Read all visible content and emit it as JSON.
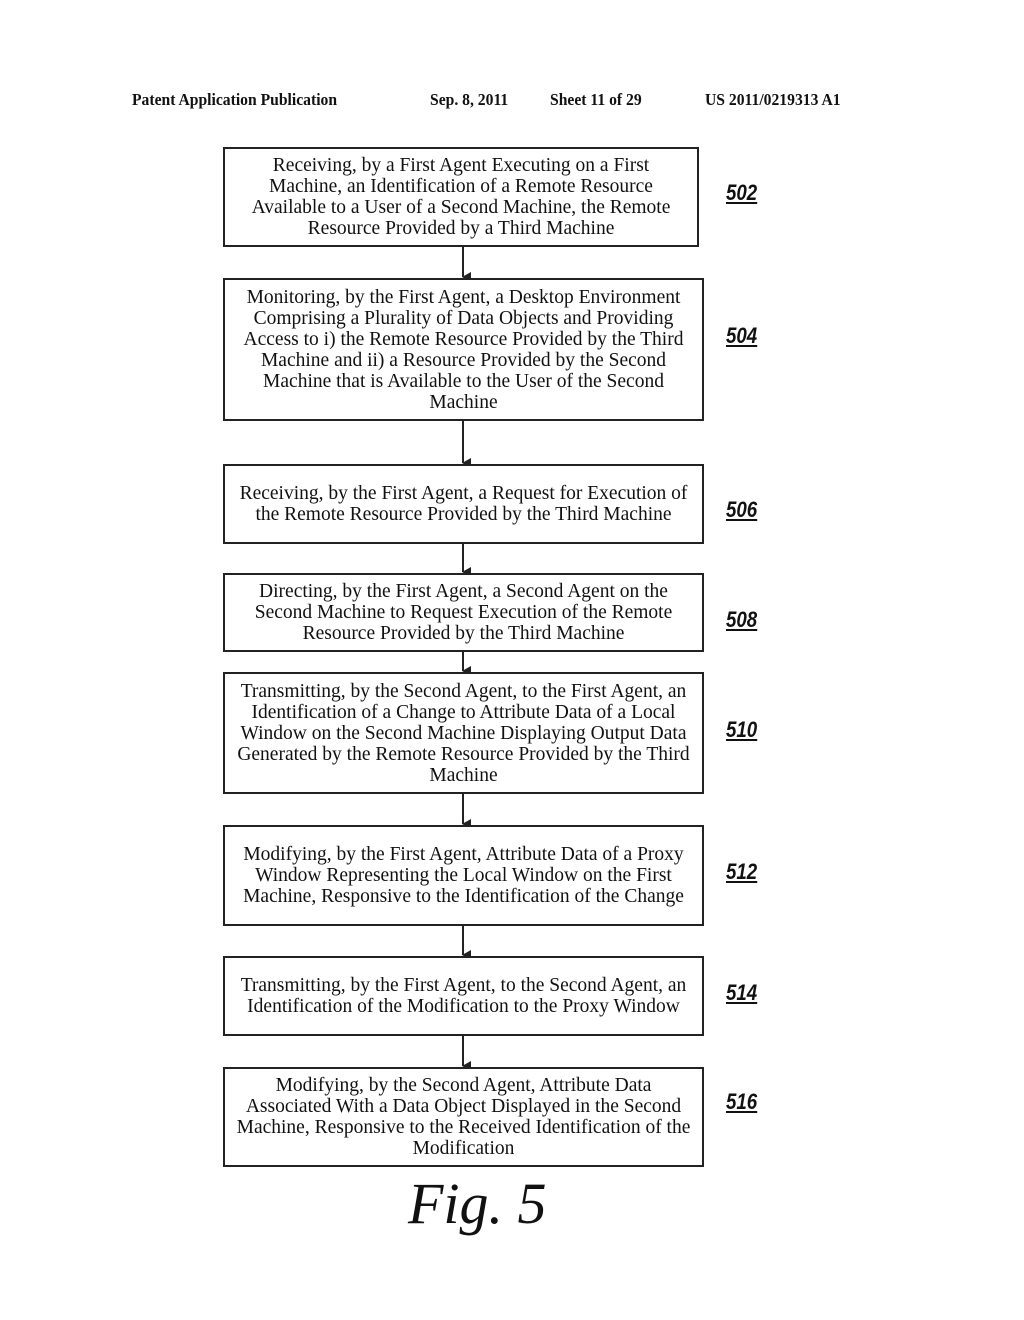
{
  "header": {
    "publication": "Patent Application Publication",
    "date": "Sep. 8, 2011",
    "sheet": "Sheet 11 of 29",
    "number": "US 2011/0219313 A1"
  },
  "steps": [
    {
      "ref": "502",
      "text": "Receiving, by a First Agent Executing on a First Machine, an Identification of a Remote Resource Available to a User of a Second Machine, the Remote Resource Provided by a Third Machine"
    },
    {
      "ref": "504",
      "text": "Monitoring, by the First Agent, a Desktop Environment Comprising a Plurality of Data Objects and Providing Access to i) the Remote Resource Provided by the Third Machine and ii) a Resource Provided by the Second Machine that is Available to the User of the Second Machine"
    },
    {
      "ref": "506",
      "text": "Receiving, by the First Agent, a Request for Execution of the Remote Resource Provided by the Third Machine"
    },
    {
      "ref": "508",
      "text": "Directing, by the First Agent, a Second Agent on the Second Machine to Request Execution of the Remote Resource Provided by the Third Machine"
    },
    {
      "ref": "510",
      "text": "Transmitting, by the Second Agent, to the First Agent, an Identification of a Change to Attribute Data of a Local Window on the Second Machine Displaying Output Data Generated by the Remote Resource Provided by the Third Machine"
    },
    {
      "ref": "512",
      "text": "Modifying, by the First Agent, Attribute Data of a Proxy Window Representing the Local Window on the First Machine, Responsive to the Identification of the Change"
    },
    {
      "ref": "514",
      "text": "Transmitting, by the First Agent, to the Second Agent, an Identification of the Modification to the Proxy Window"
    },
    {
      "ref": "516",
      "text": "Modifying, by the Second Agent, Attribute Data Associated With a Data Object Displayed in the Second Machine, Responsive to the Received Identification of the Modification"
    }
  ],
  "figure_label": "Fig. 5"
}
